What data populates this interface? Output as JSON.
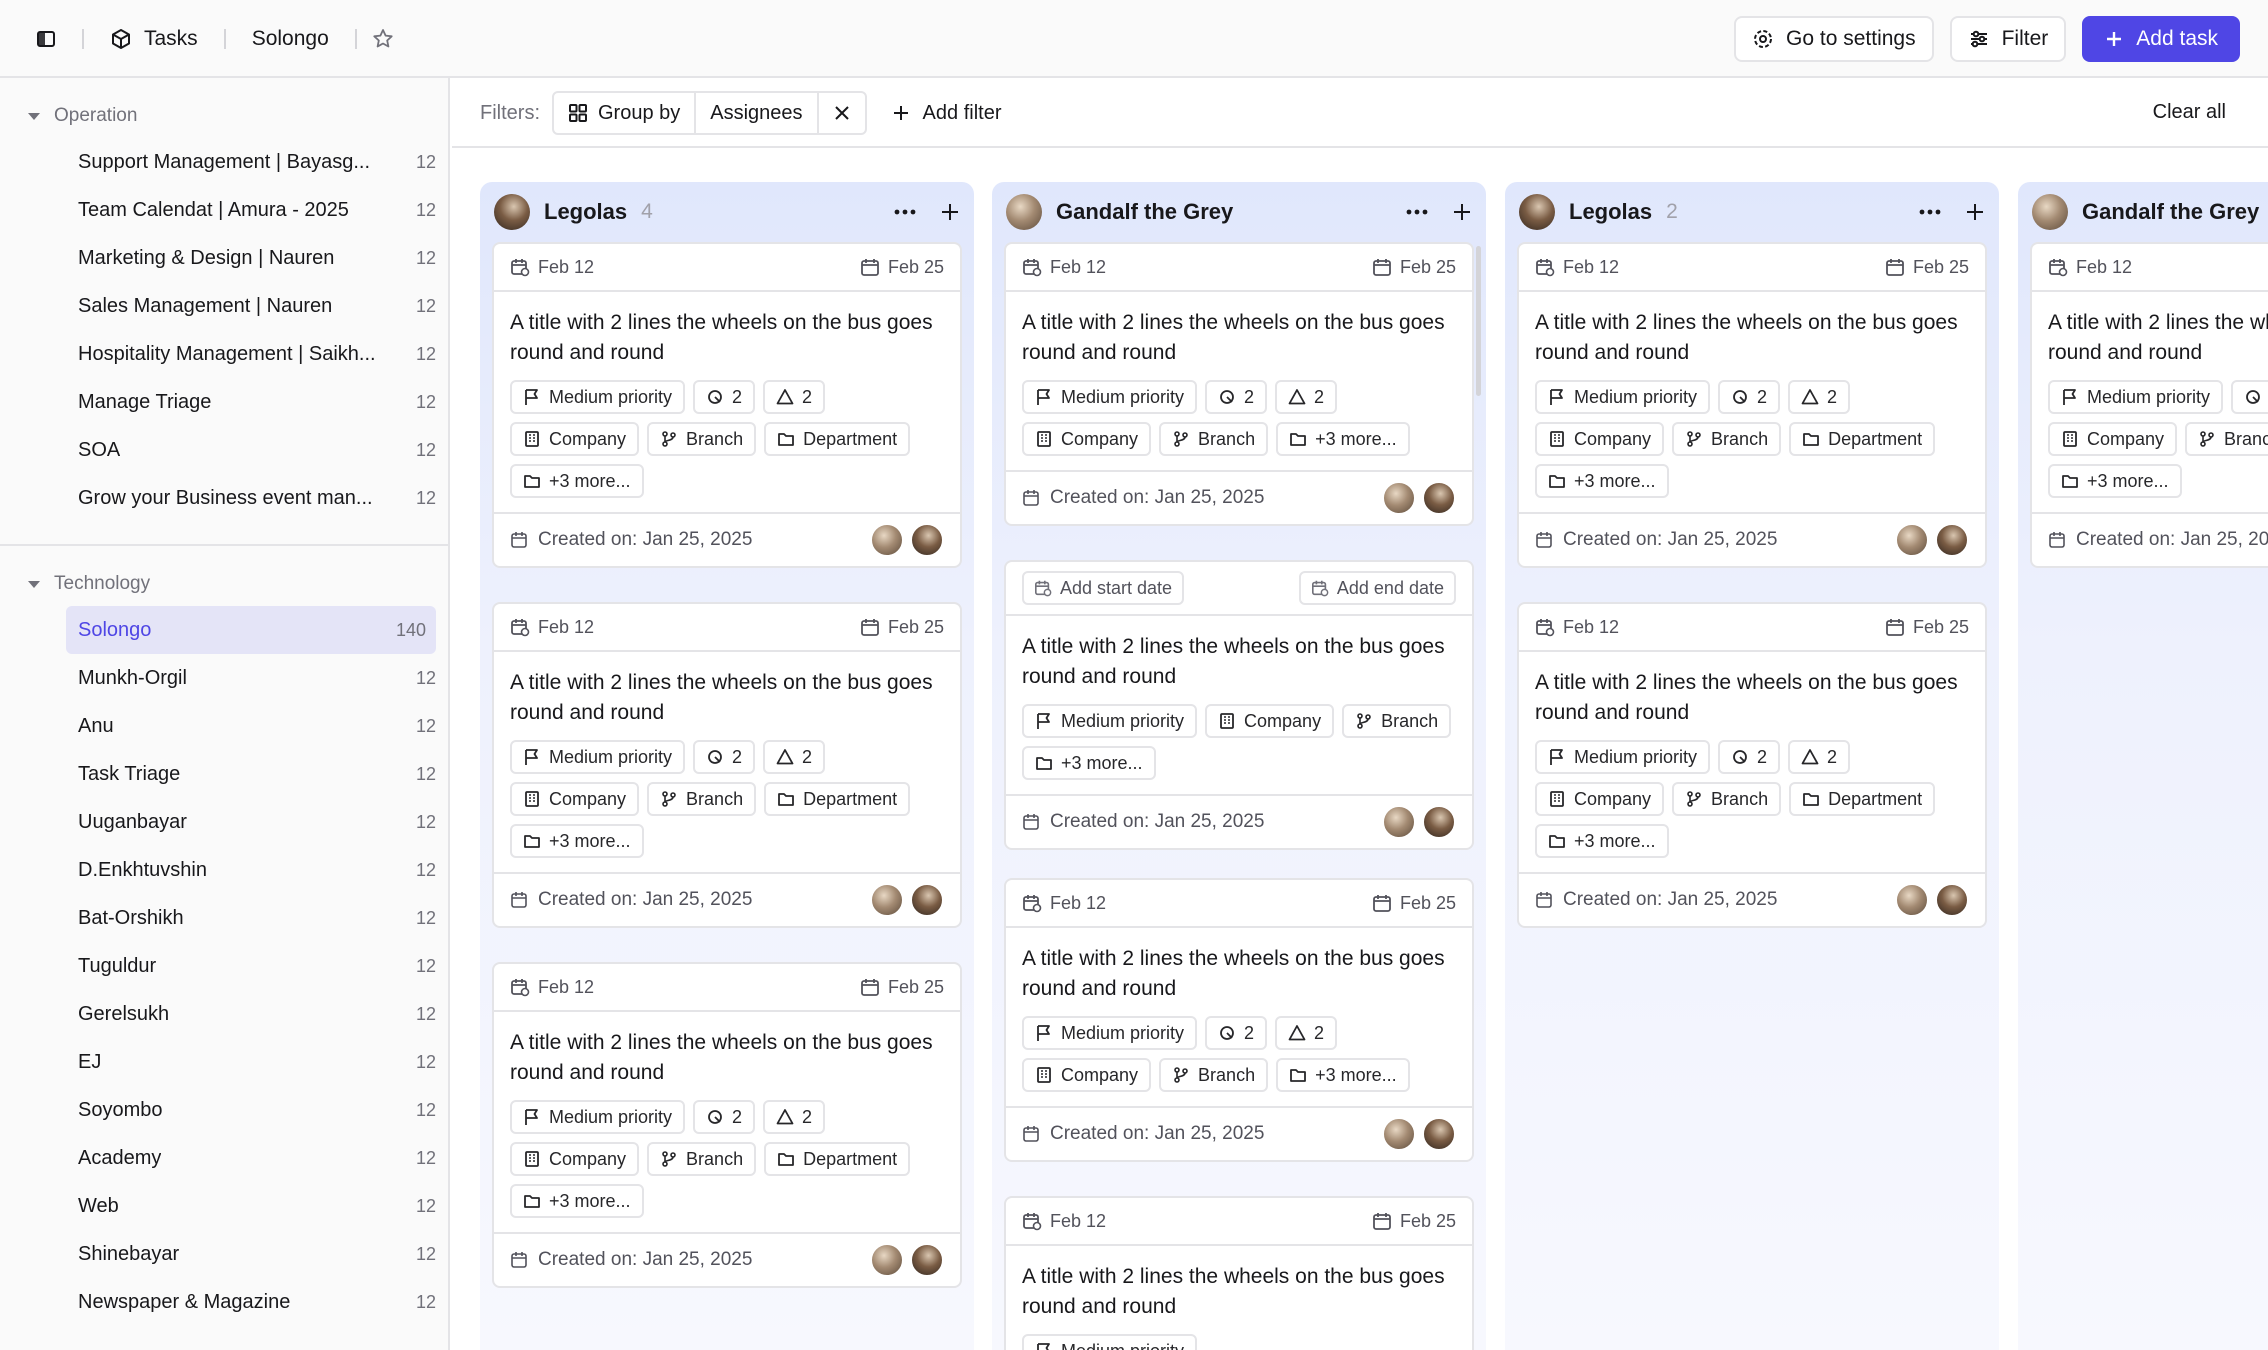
{
  "topbar": {
    "breadcrumb": [
      "Tasks",
      "Solongo"
    ],
    "settings_label": "Go to settings",
    "filter_label": "Filter",
    "add_task_label": "Add task",
    "accent_color": "#4f46e5"
  },
  "sidebar": {
    "groups": [
      {
        "title": "Operation",
        "items": [
          {
            "label": "Support Management | Bayasg...",
            "count": "12"
          },
          {
            "label": "Team Calendat | Amura - 2025",
            "count": "12"
          },
          {
            "label": "Marketing & Design | Nauren",
            "count": "12"
          },
          {
            "label": "Sales Management | Nauren",
            "count": "12"
          },
          {
            "label": "Hospitality Management | Saikh...",
            "count": "12"
          },
          {
            "label": "Manage Triage",
            "count": "12"
          },
          {
            "label": "SOA",
            "count": "12"
          },
          {
            "label": "Grow your Business event man...",
            "count": "12"
          }
        ]
      },
      {
        "title": "Technology",
        "items": [
          {
            "label": "Solongo",
            "count": "140",
            "active": true
          },
          {
            "label": "Munkh-Orgil",
            "count": "12"
          },
          {
            "label": "Anu",
            "count": "12"
          },
          {
            "label": "Task Triage",
            "count": "12"
          },
          {
            "label": "Uuganbayar",
            "count": "12"
          },
          {
            "label": "D.Enkhtuvshin",
            "count": "12"
          },
          {
            "label": "Bat-Orshikh",
            "count": "12"
          },
          {
            "label": "Tuguldur",
            "count": "12"
          },
          {
            "label": "Gerelsukh",
            "count": "12"
          },
          {
            "label": "EJ",
            "count": "12"
          },
          {
            "label": "Soyombo",
            "count": "12"
          },
          {
            "label": "Academy",
            "count": "12"
          },
          {
            "label": "Web",
            "count": "12"
          },
          {
            "label": "Shinebayar",
            "count": "12"
          },
          {
            "label": "Newspaper & Magazine",
            "count": "12"
          }
        ]
      }
    ]
  },
  "filterbar": {
    "label": "Filters:",
    "group_by_label": "Group by",
    "group_by_value": "Assignees",
    "add_filter_label": "Add filter",
    "clear_all_label": "Clear all"
  },
  "common": {
    "start_date": "Feb 12",
    "end_date": "Feb 25",
    "title": "A title with 2 lines the wheels on the bus goes round and round",
    "created": "Created on: Jan 25, 2025",
    "priority": "Medium priority",
    "subtask_count": "2",
    "issue_count": "2",
    "company": "Company",
    "branch": "Branch",
    "department": "Department",
    "more": "+3 more...",
    "add_start": "Add start date",
    "add_end": "Add end date"
  },
  "columns": [
    {
      "name": "Legolas",
      "count": "4"
    },
    {
      "name": "Gandalf the Grey",
      "count": ""
    },
    {
      "name": "Legolas",
      "count": "2"
    },
    {
      "name": "Gandalf the Grey",
      "count": ""
    }
  ]
}
